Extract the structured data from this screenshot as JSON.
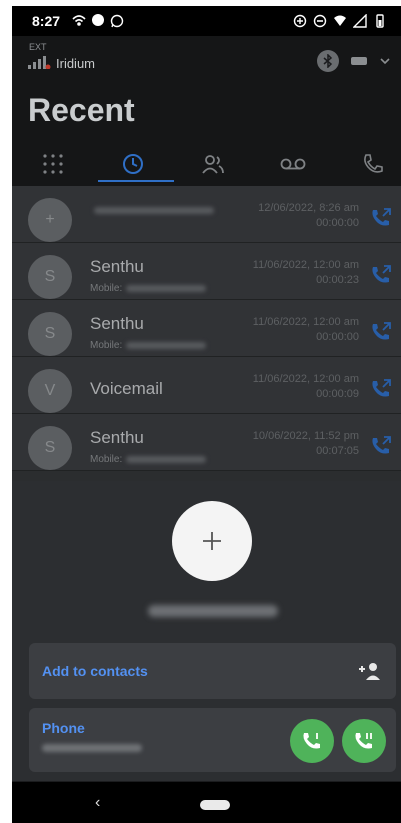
{
  "statusbar": {
    "time": "8:27"
  },
  "header": {
    "ext_label": "EXT",
    "account": "Iridium",
    "title": "Recent"
  },
  "tabs": [
    {
      "name": "keypad"
    },
    {
      "name": "recent",
      "active": true
    },
    {
      "name": "contacts"
    },
    {
      "name": "voicemail"
    },
    {
      "name": "calls"
    }
  ],
  "recent": [
    {
      "avatar": "+",
      "name": "",
      "sub": "",
      "date": "12/06/2022, 8:26 am",
      "duration": "00:00:00"
    },
    {
      "avatar": "S",
      "name": "Senthu",
      "sub": "Mobile:",
      "date": "11/06/2022, 12:00 am",
      "duration": "00:00:23"
    },
    {
      "avatar": "S",
      "name": "Senthu",
      "sub": "Mobile:",
      "date": "11/06/2022, 12:00 am",
      "duration": "00:00:00"
    },
    {
      "avatar": "V",
      "name": "Voicemail",
      "sub": "",
      "date": "11/06/2022, 12:00 am",
      "duration": "00:00:09"
    },
    {
      "avatar": "S",
      "name": "Senthu",
      "sub": "Mobile:",
      "date": "10/06/2022, 11:52 pm",
      "duration": "00:07:05"
    }
  ],
  "sheet": {
    "add_contacts_label": "Add to contacts",
    "phone_label": "Phone"
  },
  "colors": {
    "accent": "#2f6fc6",
    "link": "#5391f2",
    "call_green": "#4fb35a"
  }
}
